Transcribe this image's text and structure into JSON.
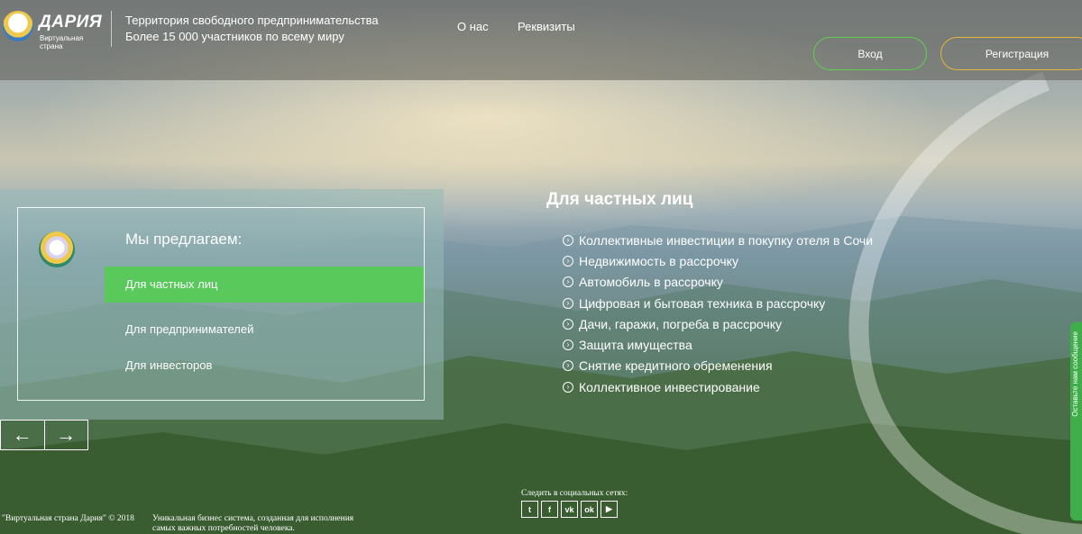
{
  "header": {
    "logo_name": "ДАРИЯ",
    "logo_sub": "Виртуальная страна",
    "tagline_line1": "Территория свободного предпринимательства",
    "tagline_line2": "Более 15 000 участников по всему миру",
    "nav": [
      "О нас",
      "Реквизиты"
    ],
    "login_label": "Вход",
    "register_label": "Регистрация"
  },
  "offer": {
    "title": "Мы предлагаем:",
    "items": [
      "Для частных лиц",
      "Для предпринимателей",
      "Для инвесторов"
    ],
    "active_index": 0
  },
  "slider": {
    "prev_icon": "arrow-left-icon",
    "next_icon": "arrow-right-icon"
  },
  "details": {
    "title": "Для частных лиц",
    "items": [
      "Коллективные инвестиции в покупку отеля в Сочи",
      "Недвижимость в рассрочку",
      "Автомобиль в рассрочку",
      "Цифровая и бытовая техника в рассрочку",
      "Дачи, гаражи, погреба в рассрочку",
      "Защита имущества",
      "Снятие кредитного обременения",
      "Коллективное инвестирование"
    ]
  },
  "footer": {
    "copyright": "\"Виртуальная страна Дария\" © 2018",
    "description": "Уникальная бизнес система, созданная для исполнения самых важных потребностей человека.",
    "social_label": "Следить в социальных сетях:",
    "social_icons": [
      "twitter-icon",
      "facebook-icon",
      "vk-icon",
      "odnoklassniki-icon",
      "youtube-icon"
    ]
  },
  "side_tab": {
    "label": "Оставьте нам сообщение"
  },
  "colors": {
    "accent_green": "#58c95a",
    "register_border": "#e8b43a",
    "login_border": "#5fcf4f"
  }
}
